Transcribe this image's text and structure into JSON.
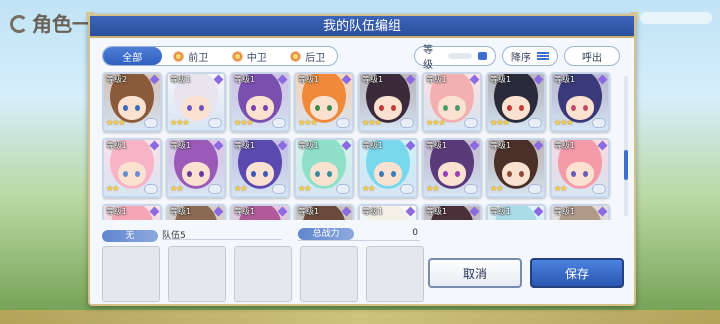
{
  "background": {
    "title": "角色一"
  },
  "dialog": {
    "title": "我的队伍编组"
  },
  "filters": {
    "tabs": [
      {
        "label": "全部",
        "active": true
      },
      {
        "label": "前卫",
        "active": false
      },
      {
        "label": "中卫",
        "active": false
      },
      {
        "label": "后卫",
        "active": false
      }
    ]
  },
  "sort": {
    "level_label": "等级",
    "order_label": "降序",
    "summon_label": "呼出"
  },
  "roster": {
    "cards": [
      {
        "level": "等级2",
        "stars": "★★★",
        "hair": "#8a5a3a",
        "eye": "#3a6ab8"
      },
      {
        "level": "等级1",
        "stars": "★★★",
        "hair": "#e8e4ee",
        "eye": "#6a58c0"
      },
      {
        "level": "等级1",
        "stars": "★★★",
        "hair": "#7a4fb0",
        "eye": "#7a3fb0"
      },
      {
        "level": "等级1",
        "stars": "★★★",
        "hair": "#f08a3a",
        "eye": "#3a8a4a"
      },
      {
        "level": "等级1",
        "stars": "★★★",
        "hair": "#3a2a3a",
        "eye": "#c03a3a"
      },
      {
        "level": "等级1",
        "stars": "★★★",
        "hair": "#f4b0b0",
        "eye": "#4a9a6a"
      },
      {
        "level": "等级1",
        "stars": "★★★",
        "hair": "#2a2a3a",
        "eye": "#c03a3a"
      },
      {
        "level": "等级1",
        "stars": "★★★",
        "hair": "#3a3a7a",
        "eye": "#c04a6a"
      },
      {
        "level": "等级1",
        "stars": "★★",
        "hair": "#f6b4c6",
        "eye": "#6a8ad0"
      },
      {
        "level": "等级1",
        "stars": "★★",
        "hair": "#9a5ab8",
        "eye": "#6a3a9a"
      },
      {
        "level": "等级1",
        "stars": "★★",
        "hair": "#5a4ab0",
        "eye": "#3a5ab8"
      },
      {
        "level": "等级1",
        "stars": "★★",
        "hair": "#8ee0c8",
        "eye": "#3a8a9a"
      },
      {
        "level": "等级1",
        "stars": "★★",
        "hair": "#7ad8ee",
        "eye": "#3a7ab8"
      },
      {
        "level": "等级1",
        "stars": "★★",
        "hair": "#5a3a7a",
        "eye": "#9a3ab8"
      },
      {
        "level": "等级1",
        "stars": "★★",
        "hair": "#4a3028",
        "eye": "#8a4a3a"
      },
      {
        "level": "等级1",
        "stars": "★★",
        "hair": "#f49aa8",
        "eye": "#6a5ab8"
      },
      {
        "level": "等级1",
        "stars": "",
        "hair": "#f4a6b4",
        "eye": "#5a6ab8"
      },
      {
        "level": "等级1",
        "stars": "",
        "hair": "#8a6a50",
        "eye": "#3a3a5a"
      },
      {
        "level": "等级1",
        "stars": "",
        "hair": "#b05a9a",
        "eye": "#5a3a8a"
      },
      {
        "level": "等级1",
        "stars": "",
        "hair": "#6a4a3a",
        "eye": "#3a3a5a"
      },
      {
        "level": "等级1",
        "stars": "",
        "hair": "#f4f0e8",
        "eye": "#6a8ab8"
      },
      {
        "level": "等级1",
        "stars": "",
        "hair": "#4a3038",
        "eye": "#7a3a4a"
      },
      {
        "level": "等级1",
        "stars": "",
        "hair": "#a8dde8",
        "eye": "#3a7ab8"
      },
      {
        "level": "等级1",
        "stars": "",
        "hair": "#b09a8a",
        "eye": "#4a4a6a"
      }
    ]
  },
  "team": {
    "pill_label": "无",
    "name": "队伍5",
    "power_label": "总战力",
    "power_value": "0",
    "slots": 5
  },
  "actions": {
    "cancel_label": "取消",
    "save_label": "保存"
  },
  "colors": {
    "accent": "#2f5fbf",
    "frame": "#d6c08a"
  }
}
